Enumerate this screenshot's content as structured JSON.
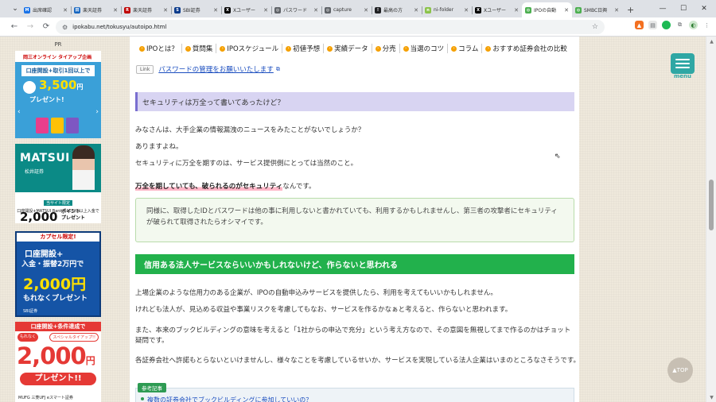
{
  "browser": {
    "tabs": [
      {
        "title": "出席確認",
        "favicon_color": "#1a73e8",
        "favicon_text": "M"
      },
      {
        "title": "楽天証券",
        "favicon_color": "#1565c0",
        "favicon_text": "田"
      },
      {
        "title": "楽天証券",
        "favicon_color": "#bf0000",
        "favicon_text": "R"
      },
      {
        "title": "SBI証券",
        "favicon_color": "#0b3b8c",
        "favicon_text": "S"
      },
      {
        "title": "Xユーザー",
        "favicon_color": "#000000",
        "favicon_text": "X"
      },
      {
        "title": "パスワード",
        "favicon_color": "#5f6368",
        "favicon_text": "◎"
      },
      {
        "title": "capture",
        "favicon_color": "#5f6368",
        "favicon_text": "◎"
      },
      {
        "title": "最高の方",
        "favicon_color": "#202124",
        "favicon_text": "!"
      },
      {
        "title": "ni-folder",
        "favicon_color": "#8bc34a",
        "favicon_text": "n"
      },
      {
        "title": "Xユーザー",
        "favicon_color": "#000000",
        "favicon_text": "X"
      },
      {
        "title": "IPOの自動",
        "favicon_color": "#4caf50",
        "favicon_text": "◍"
      },
      {
        "title": "SMBC日興",
        "favicon_color": "#4caf50",
        "favicon_text": "◍"
      }
    ],
    "active_tab_index": 10,
    "url": "ipokabu.net/tokusyu/autoipo.html"
  },
  "ads": {
    "pr_label": "PR",
    "ad1": {
      "header": "岡三オンライン タイアップ企画",
      "line": "口座開設+取引1回以上で",
      "amount": "3,500",
      "amount_unit": "円",
      "present": "プレゼント!"
    },
    "ad2": {
      "logo": "MATSUI",
      "sub": "松井証券"
    },
    "ad3": {
      "badge": "当サイト限定",
      "line": "口座開設+MATSUI Bankへ10万円以上入金で",
      "amount": "2,000",
      "unit_line1": "ポイント",
      "unit_line2": "プレゼント"
    },
    "ad4": {
      "tag": "カプセル限定!",
      "line1": "口座開設+",
      "line2": "入金・振替2万円で",
      "amount": "2,000円",
      "line3": "もれなくプレゼント",
      "brand": "SBI証券"
    },
    "ad5": {
      "top": "口座開設+条件達成で",
      "chip1": "もれなく",
      "chip2": "スペシャルタイアップ!!",
      "amount": "2,000",
      "unit": "円",
      "present": "プレゼント!!",
      "brand": "MUFG 三菱UFJ eスマート証券"
    }
  },
  "nav": {
    "items": [
      "IPOとは？",
      "質問集",
      "IPOスケジュール",
      "初値予想",
      "実績データ",
      "分売",
      "当選のコツ",
      "コラム",
      "おすすめ証券会社の比較"
    ]
  },
  "article": {
    "link_chip": "Link",
    "link_text": "パスワードの管理をお願いいたします",
    "heading1": "セキュリティは万全って書いてあったけど？",
    "p1": "みなさんは、大手企業の情報漏洩のニュースをみたことがないでしょうか？",
    "p2": "ありますよね。",
    "p3": "セキュリティに万全を期すのは、サービス提供側にとっては当然のこと。",
    "p4_bold": "万全を期していても、破られるのがセキュリティ",
    "p4_rest": "なんです。",
    "note": "同様に、取得したIDとパスワードは他の事に利用しないと書かれていても、利用するかもしれませんし、第三者の攻撃者にセキュリティが破られて取得されたらオシマイです。",
    "heading2": "信用ある法人サービスならいいかもしれないけど、作らないと思われる",
    "p5": "上場企業のような信用力のある企業が、IPOの自動申込みサービスを提供したら、利用を考えてもいいかもしれません。",
    "p6": "けれども法人が、見込める収益や事業リスクを考慮してもなお、サービスを作るかなぁと考えると、作らないと思われます。",
    "p7": "また、本来のブックビルディングの意味を考えると「1社からの申込で充分」という考え方なので、その意図を無視してまで作るのかはチョット疑問です。",
    "p8": "各証券会社へ許諾もとらないといけませんし、様々なことを考慮しているせいか、サービスを実現している法人企業はいまのところなさそうです。",
    "ref_label": "参考記事",
    "ref_link": "複数の証券会社でブックビルディングに参加していいの？"
  },
  "widgets": {
    "menu_label": "menu",
    "totop_label": "▲TOP"
  },
  "colors": {
    "accent_green": "#22b14c",
    "heading_purple": "#d8d4f2",
    "menu_teal": "#2fa7a4",
    "nav_dot": "#f5a000"
  }
}
